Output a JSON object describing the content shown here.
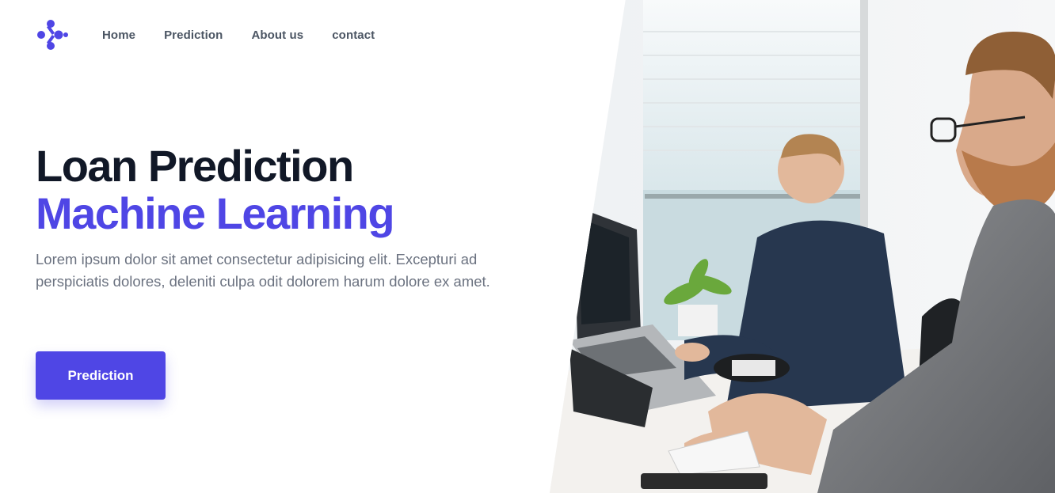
{
  "brand": {
    "logo_icon": "molecule-logo-icon",
    "accent_color": "#4f46e5"
  },
  "nav": {
    "items": [
      {
        "label": "Home"
      },
      {
        "label": "Prediction"
      },
      {
        "label": "About us"
      },
      {
        "label": "contact"
      }
    ]
  },
  "hero": {
    "title_line1": "Loan Prediction",
    "title_line2": "Machine Learning",
    "description": "Lorem ipsum dolor sit amet consectetur adipisicing elit. Excepturi ad perspiciatis dolores, deleniti culpa odit dolorem harum dolore ex amet.",
    "cta_label": "Prediction"
  },
  "image": {
    "subject": "office-photo-two-men-at-computers"
  }
}
